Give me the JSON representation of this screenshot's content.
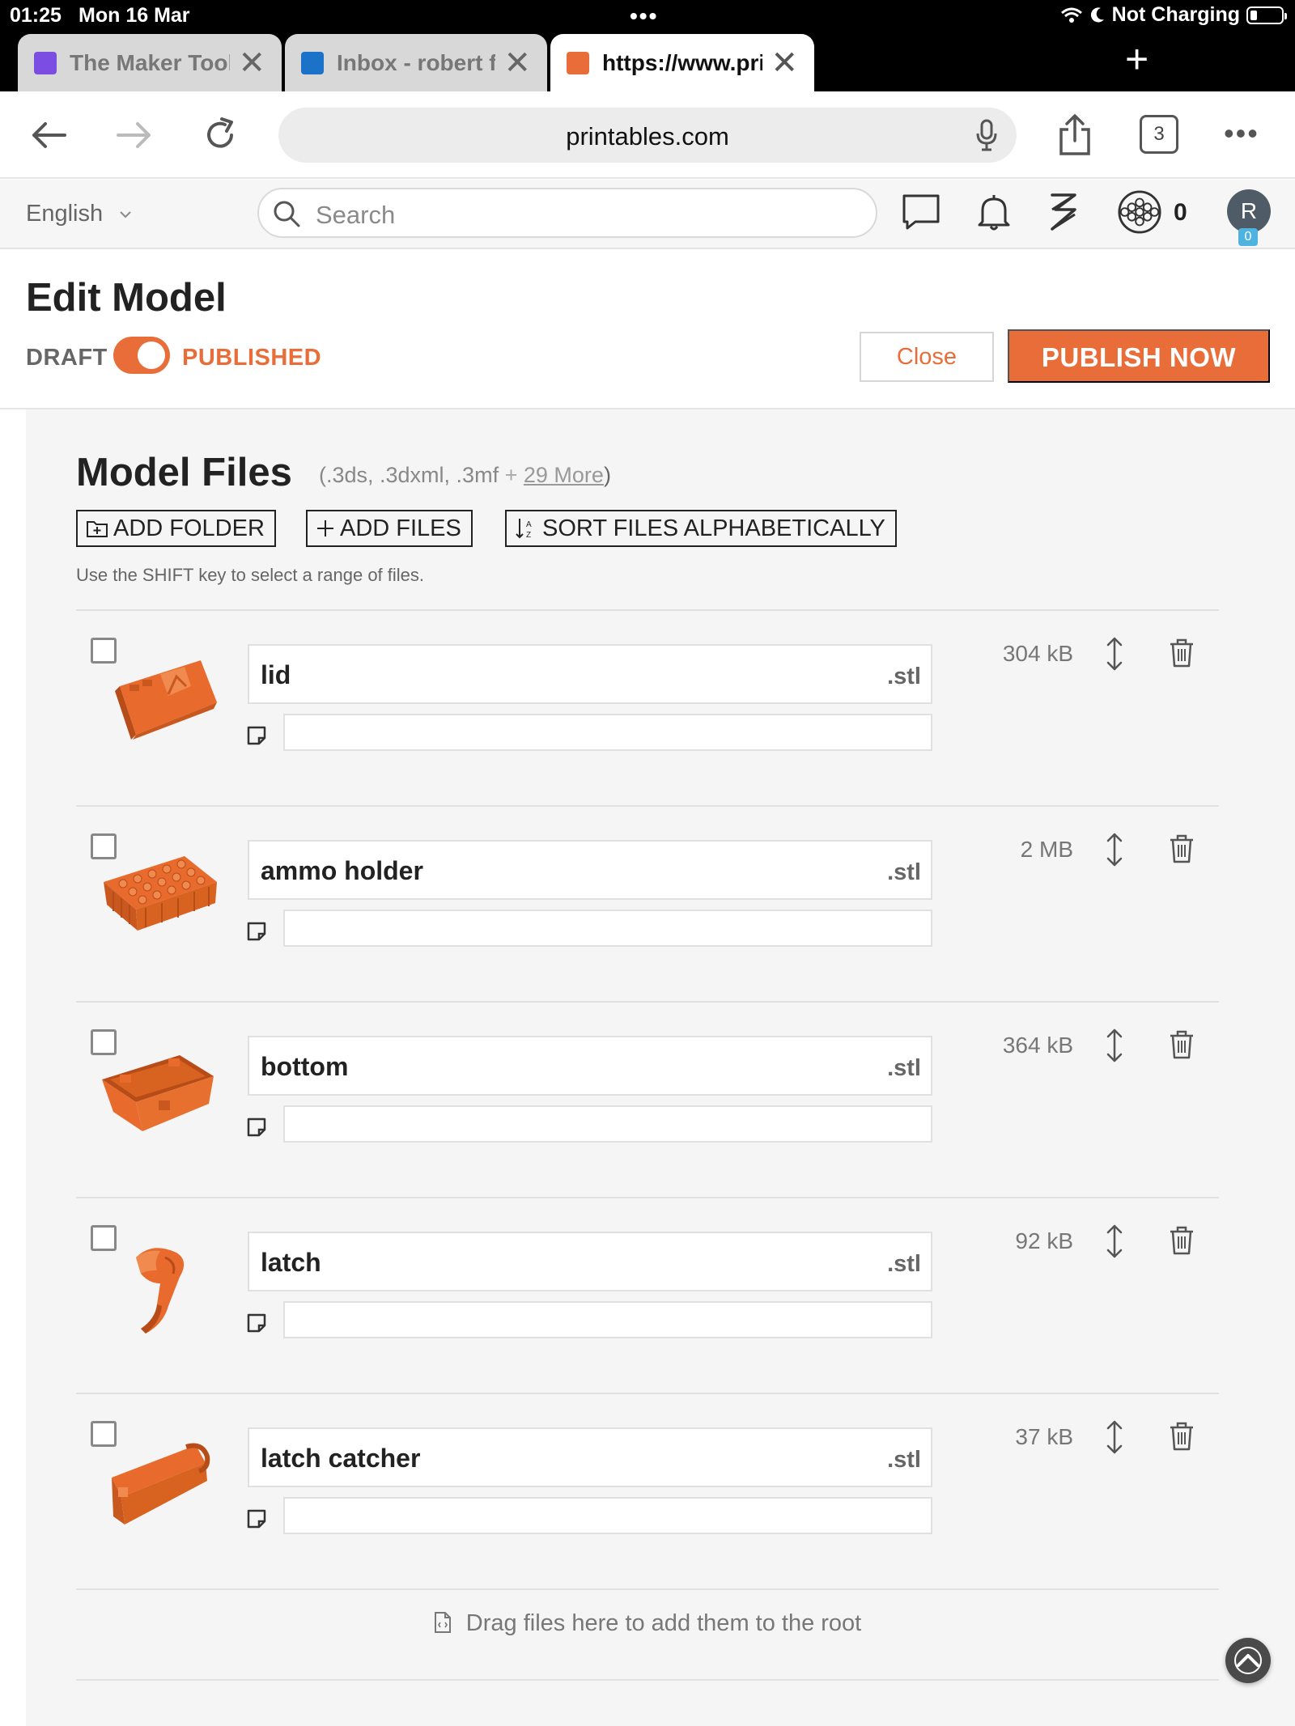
{
  "status_bar": {
    "time": "01:25",
    "date": "Mon 16 Mar",
    "charging": "Not Charging"
  },
  "tabs": [
    {
      "title": "The Maker Toolbox: dire",
      "favicon_color": "#7b4de3"
    },
    {
      "title": "Inbox - robert flood - Ou",
      "favicon_color": "#1a73c9"
    },
    {
      "title": "https://www.printables.",
      "favicon_color": "#e96d38"
    }
  ],
  "browser": {
    "url": "printables.com",
    "tab_count": "3"
  },
  "site_header": {
    "language": "English",
    "search_placeholder": "Search",
    "points": "0",
    "avatar_letter": "R",
    "avatar_badge": "0"
  },
  "edit": {
    "title": "Edit Model",
    "draft_label": "DRAFT",
    "published_label": "PUBLISHED",
    "close_label": "Close",
    "publish_label": "PUBLISH NOW"
  },
  "files_section": {
    "title": "Model Files",
    "extensions": "(.3ds, .3dxml, .3mf",
    "plus": "+",
    "more_link": "29 More",
    "closing_paren": ")",
    "add_folder": "ADD FOLDER",
    "add_files": "ADD FILES",
    "sort_files": "SORT FILES ALPHABETICALLY",
    "hint": "Use the SHIFT key to select a range of files.",
    "drop_hint": "Drag files here to add them to the root"
  },
  "files": [
    {
      "name": "lid",
      "ext": ".stl",
      "size": "304 kB",
      "note": ""
    },
    {
      "name": "ammo holder",
      "ext": ".stl",
      "size": "2 MB",
      "note": ""
    },
    {
      "name": "bottom",
      "ext": ".stl",
      "size": "364 kB",
      "note": ""
    },
    {
      "name": "latch",
      "ext": ".stl",
      "size": "92 kB",
      "note": ""
    },
    {
      "name": "latch catcher",
      "ext": ".stl",
      "size": "37 kB",
      "note": ""
    }
  ],
  "colors": {
    "accent": "#e96d38",
    "thumb_orange": "#e86a2c"
  }
}
